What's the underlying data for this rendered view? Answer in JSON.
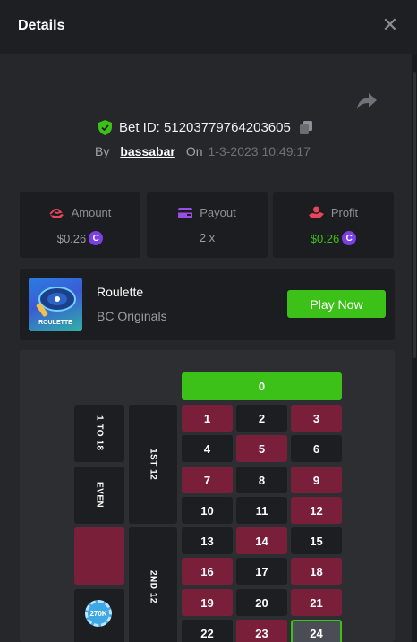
{
  "header": {
    "title": "Details",
    "close_glyph": "✕"
  },
  "bet": {
    "id_text": "Bet ID: 51203779764203605",
    "by_label": "By",
    "username": "bassabar",
    "on_label": "On",
    "date": "1-3-2023 10:49:17"
  },
  "stats": {
    "amount": {
      "label": "Amount",
      "value": "$0.26",
      "icon": "amount-hand-icon"
    },
    "payout": {
      "label": "Payout",
      "value": "2 x",
      "icon": "wallet-icon"
    },
    "profit": {
      "label": "Profit",
      "value": "$0.26",
      "icon": "profit-hand-icon"
    },
    "coin_glyph": "C"
  },
  "game": {
    "name": "Roulette",
    "provider": "BC Originals",
    "thumb_label": "ROULETTE",
    "play_label": "Play Now"
  },
  "roulette": {
    "zero": "0",
    "numbers": [
      [
        "1",
        "2",
        "3"
      ],
      [
        "4",
        "5",
        "6"
      ],
      [
        "7",
        "8",
        "9"
      ],
      [
        "10",
        "11",
        "12"
      ],
      [
        "13",
        "14",
        "15"
      ],
      [
        "16",
        "17",
        "18"
      ],
      [
        "19",
        "20",
        "21"
      ],
      [
        "22",
        "23",
        "24"
      ]
    ],
    "bets": {
      "low": "1 TO 18",
      "even": "EVEN",
      "dozen1": "1ST 12",
      "dozen2": "2ND 12"
    },
    "chip_label": "270K"
  },
  "colors": {
    "accent_green": "#3bc117",
    "red_cell": "#7a1f3a",
    "black_cell": "#1d1e21",
    "coin": "#7b3fe4",
    "amount_icon": "#e8455a"
  }
}
